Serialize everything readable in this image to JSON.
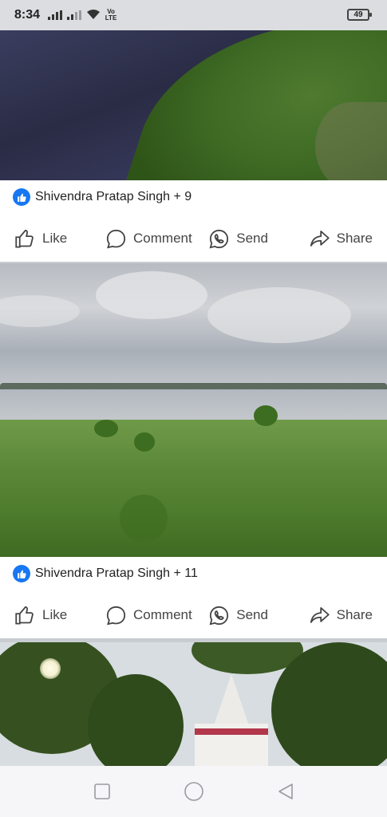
{
  "status_bar": {
    "time": "8:34",
    "network_label": "Vo LTE",
    "battery_level": "49"
  },
  "feed": {
    "posts": [
      {
        "reaction_summary": "Shivendra Pratap Singh + 9"
      },
      {
        "reaction_summary": "Shivendra Pratap Singh + 11"
      }
    ],
    "actions": {
      "like": "Like",
      "comment": "Comment",
      "send": "Send",
      "share": "Share"
    }
  },
  "nav_bar": {
    "icons": [
      "recents-square-icon",
      "home-circle-icon",
      "back-triangle-icon"
    ]
  },
  "colors": {
    "accent": "#1877f2",
    "action_text": "#444444",
    "card_bg": "#ffffff",
    "separator": "#c9ccd1"
  }
}
